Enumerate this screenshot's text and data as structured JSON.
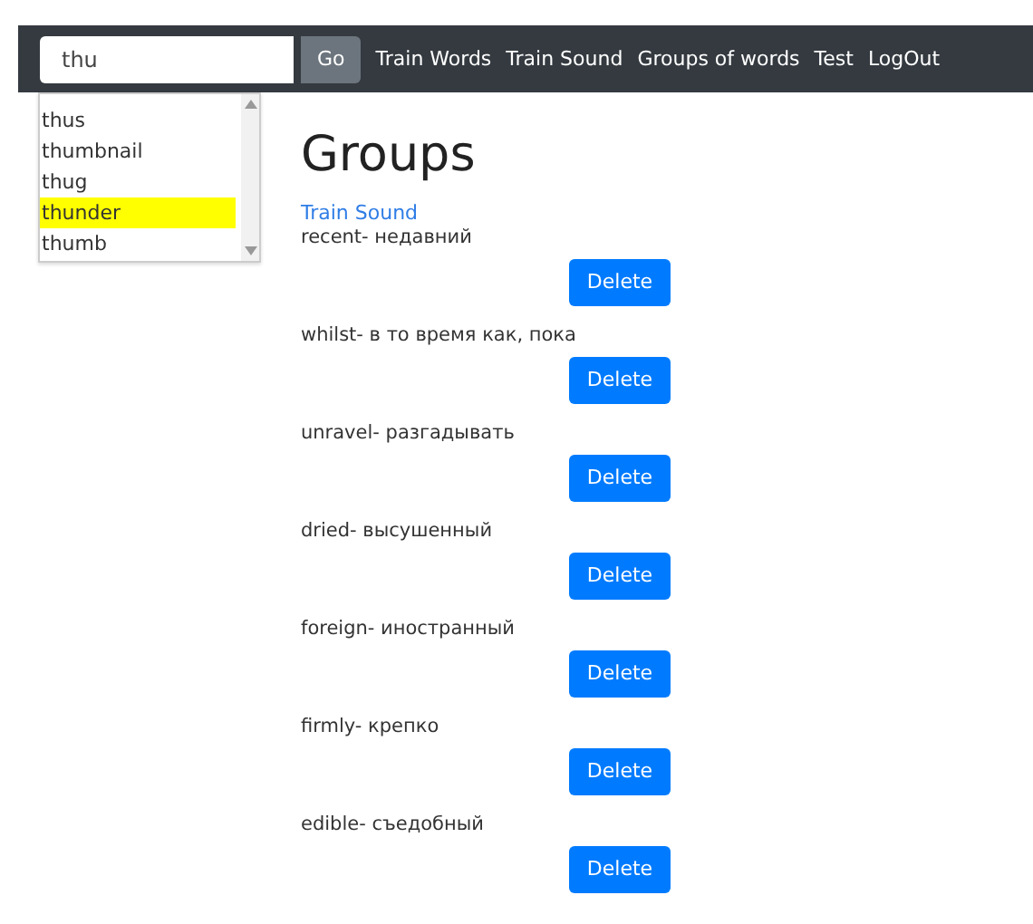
{
  "navbar": {
    "search": {
      "value": "thu"
    },
    "go_button": "Go",
    "links": [
      "Train Words",
      "Train Sound",
      "Groups of words",
      "Test",
      "LogOut"
    ]
  },
  "suggestions": [
    {
      "label": "thus",
      "selected": false
    },
    {
      "label": "thumbnail",
      "selected": false
    },
    {
      "label": "thug",
      "selected": false
    },
    {
      "label": "thunder",
      "selected": true
    },
    {
      "label": "thumb",
      "selected": false
    }
  ],
  "heading": "Groups",
  "train_link": "Train Sound",
  "words": [
    {
      "text": "recent- недавний",
      "button": "Delete"
    },
    {
      "text": "whilst- в то время как, пока",
      "button": "Delete"
    },
    {
      "text": "unravel- разгадывать",
      "button": "Delete"
    },
    {
      "text": "dried- высушенный",
      "button": "Delete"
    },
    {
      "text": "foreign- иностранный",
      "button": "Delete"
    },
    {
      "text": "firmly- крепко",
      "button": "Delete"
    },
    {
      "text": "edible- съедобный",
      "button": "Delete"
    }
  ]
}
